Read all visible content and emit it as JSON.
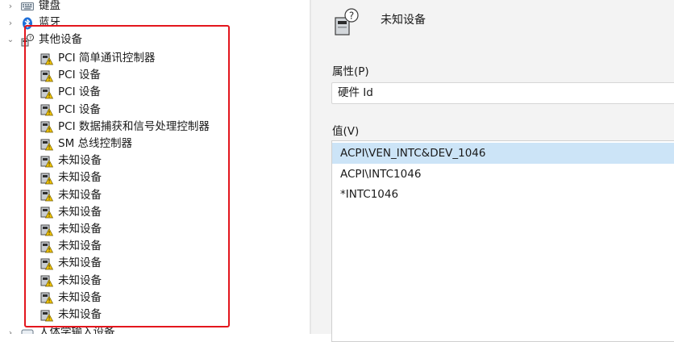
{
  "tree": {
    "top_items": [
      {
        "label": "键盘",
        "icon": "keyboard-icon"
      },
      {
        "label": "蓝牙",
        "icon": "bluetooth-icon"
      }
    ],
    "group": {
      "label": "其他设备",
      "icon": "unknown-device-group-icon"
    },
    "children": [
      "PCI 简单通讯控制器",
      "PCI 设备",
      "PCI 设备",
      "PCI 设备",
      "PCI 数据捕获和信号处理控制器",
      "SM 总线控制器",
      "未知设备",
      "未知设备",
      "未知设备",
      "未知设备",
      "未知设备",
      "未知设备",
      "未知设备",
      "未知设备",
      "未知设备",
      "未知设备"
    ],
    "bottom_item": {
      "label": "人体学输入设备"
    },
    "highlight_color": "#e3161d"
  },
  "dialog": {
    "device_name": "未知设备",
    "property_label": "属性(P)",
    "property_value": "硬件 Id",
    "value_label": "值(V)",
    "values": [
      "ACPI\\VEN_INTC&DEV_1046",
      "ACPI\\INTC1046",
      "*INTC1046"
    ],
    "selected_color": "#cce4f7"
  }
}
